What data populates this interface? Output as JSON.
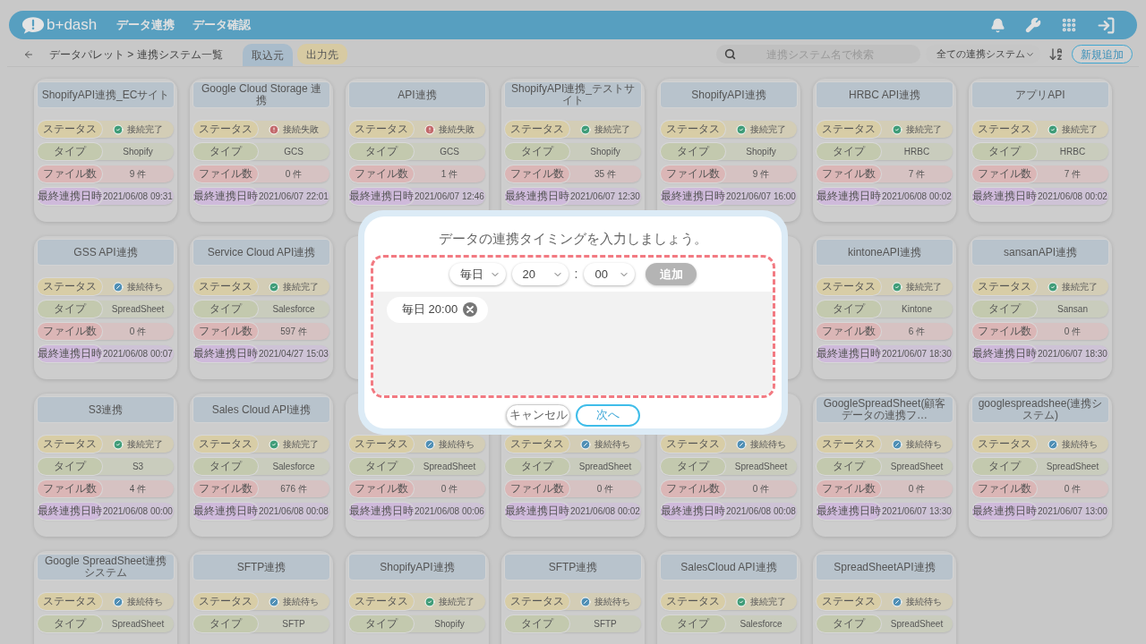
{
  "header": {
    "logo": "b+dash",
    "nav": [
      "データ連携",
      "データ確認"
    ]
  },
  "toolbar": {
    "breadcrumb": "データパレット > 連携システム一覧",
    "tabs": [
      {
        "label": "取込元",
        "selected": true
      },
      {
        "label": "出力先",
        "selected": false
      }
    ],
    "search": {
      "placeholder": "連携システム名で検索"
    },
    "filter": {
      "value": "全ての連携システム"
    },
    "new_button": "新規追加"
  },
  "cards": [
    {
      "title": "ShopifyAPI連携_ECサイト",
      "fields": [
        {
          "kind": "status",
          "label": "ステータス",
          "value": "接続完了",
          "icon": {
            "kind": "check",
            "color": "#3f9c78"
          }
        },
        {
          "kind": "type",
          "label": "タイプ",
          "value": "Shopify"
        },
        {
          "kind": "files",
          "label": "ファイル数",
          "value": "9 件"
        },
        {
          "kind": "date",
          "label": "最終連携日時",
          "value": "2021/06/08 09:31"
        }
      ]
    },
    {
      "title": "Google Cloud Storage 連携",
      "fields": [
        {
          "kind": "status",
          "label": "ステータス",
          "value": "接続失敗",
          "icon": {
            "kind": "alert",
            "color": "#c2696b"
          }
        },
        {
          "kind": "type",
          "label": "タイプ",
          "value": "GCS"
        },
        {
          "kind": "files",
          "label": "ファイル数",
          "value": "0 件"
        },
        {
          "kind": "date",
          "label": "最終連携日時",
          "value": "2021/06/07 22:01"
        }
      ]
    },
    {
      "title": "API連携",
      "fields": [
        {
          "kind": "status",
          "label": "ステータス",
          "value": "接続失敗",
          "icon": {
            "kind": "alert",
            "color": "#c2696b"
          }
        },
        {
          "kind": "type",
          "label": "タイプ",
          "value": "GCS"
        },
        {
          "kind": "files",
          "label": "ファイル数",
          "value": "1 件"
        },
        {
          "kind": "date",
          "label": "最終連携日時",
          "value": "2021/06/07 12:46"
        }
      ]
    },
    {
      "title": "ShopifyAPI連携_テストサイト",
      "fields": [
        {
          "kind": "status",
          "label": "ステータス",
          "value": "接続完了",
          "icon": {
            "kind": "check",
            "color": "#3f9c78"
          }
        },
        {
          "kind": "type",
          "label": "タイプ",
          "value": "Shopify"
        },
        {
          "kind": "files",
          "label": "ファイル数",
          "value": "35 件"
        },
        {
          "kind": "date",
          "label": "最終連携日時",
          "value": "2021/06/07 12:30"
        }
      ]
    },
    {
      "title": "ShopifyAPI連携",
      "fields": [
        {
          "kind": "status",
          "label": "ステータス",
          "value": "接続完了",
          "icon": {
            "kind": "check",
            "color": "#3f9c78"
          }
        },
        {
          "kind": "type",
          "label": "タイプ",
          "value": "Shopify"
        },
        {
          "kind": "files",
          "label": "ファイル数",
          "value": "9 件"
        },
        {
          "kind": "date",
          "label": "最終連携日時",
          "value": "2021/06/07 16:00"
        }
      ]
    },
    {
      "title": "HRBC API連携",
      "fields": [
        {
          "kind": "status",
          "label": "ステータス",
          "value": "接続完了",
          "icon": {
            "kind": "check",
            "color": "#3f9c78"
          }
        },
        {
          "kind": "type",
          "label": "タイプ",
          "value": "HRBC"
        },
        {
          "kind": "files",
          "label": "ファイル数",
          "value": "7 件"
        },
        {
          "kind": "date",
          "label": "最終連携日時",
          "value": "2021/06/08 00:02"
        }
      ]
    },
    {
      "title": "アプリAPI",
      "fields": [
        {
          "kind": "status",
          "label": "ステータス",
          "value": "接続完了",
          "icon": {
            "kind": "check",
            "color": "#3f9c78"
          }
        },
        {
          "kind": "type",
          "label": "タイプ",
          "value": "HRBC"
        },
        {
          "kind": "files",
          "label": "ファイル数",
          "value": "7 件"
        },
        {
          "kind": "date",
          "label": "最終連携日時",
          "value": "2021/06/08 00:02"
        }
      ]
    },
    {
      "title": "GSS API連携",
      "fields": [
        {
          "kind": "status",
          "label": "ステータス",
          "value": "接続待ち",
          "icon": {
            "kind": "slash",
            "color": "#4f8fb5"
          }
        },
        {
          "kind": "type",
          "label": "タイプ",
          "value": "SpreadSheet"
        },
        {
          "kind": "files",
          "label": "ファイル数",
          "value": "0 件"
        },
        {
          "kind": "date",
          "label": "最終連携日時",
          "value": "2021/06/08 00:07"
        }
      ]
    },
    {
      "title": "Service Cloud API連携",
      "fields": [
        {
          "kind": "status",
          "label": "ステータス",
          "value": "接続完了",
          "icon": {
            "kind": "check",
            "color": "#3f9c78"
          }
        },
        {
          "kind": "type",
          "label": "タイプ",
          "value": "Salesforce"
        },
        {
          "kind": "files",
          "label": "ファイル数",
          "value": "597 件"
        },
        {
          "kind": "date",
          "label": "最終連携日時",
          "value": "2021/04/27 15:03"
        }
      ]
    },
    {
      "kind": "covered"
    },
    {
      "kind": "hidden"
    },
    {
      "kind": "covered"
    },
    {
      "title": "kintoneAPI連携",
      "fields": [
        {
          "kind": "status",
          "label": "ステータス",
          "value": "接続完了",
          "icon": {
            "kind": "check",
            "color": "#3f9c78"
          }
        },
        {
          "kind": "type",
          "label": "タイプ",
          "value": "Kintone"
        },
        {
          "kind": "files",
          "label": "ファイル数",
          "value": "6 件"
        },
        {
          "kind": "date",
          "label": "最終連携日時",
          "value": "2021/06/07 18:30"
        }
      ]
    },
    {
      "title": "sansanAPI連携",
      "fields": [
        {
          "kind": "status",
          "label": "ステータス",
          "value": "接続完了",
          "icon": {
            "kind": "check",
            "color": "#3f9c78"
          }
        },
        {
          "kind": "type",
          "label": "タイプ",
          "value": "Sansan"
        },
        {
          "kind": "files",
          "label": "ファイル数",
          "value": "0 件"
        },
        {
          "kind": "date",
          "label": "最終連携日時",
          "value": "2021/06/07 18:30"
        }
      ]
    },
    {
      "title": "S3連携",
      "fields": [
        {
          "kind": "status",
          "label": "ステータス",
          "value": "接続完了",
          "icon": {
            "kind": "check",
            "color": "#3f9c78"
          }
        },
        {
          "kind": "type",
          "label": "タイプ",
          "value": "S3"
        },
        {
          "kind": "files",
          "label": "ファイル数",
          "value": "4 件"
        },
        {
          "kind": "date",
          "label": "最終連携日時",
          "value": "2021/06/08 00:00"
        }
      ]
    },
    {
      "title": "Sales Cloud API連携",
      "fields": [
        {
          "kind": "status",
          "label": "ステータス",
          "value": "接続完了",
          "icon": {
            "kind": "check",
            "color": "#3f9c78"
          }
        },
        {
          "kind": "type",
          "label": "タイプ",
          "value": "Salesforce"
        },
        {
          "kind": "files",
          "label": "ファイル数",
          "value": "676 件"
        },
        {
          "kind": "date",
          "label": "最終連携日時",
          "value": "2021/06/08 00:08"
        }
      ]
    },
    {
      "fields": [
        {
          "kind": "status",
          "label": "ステータス",
          "value": "接続待ち",
          "icon": {
            "kind": "slash",
            "color": "#4f8fb5"
          }
        },
        {
          "kind": "type",
          "label": "タイプ",
          "value": "SpreadSheet"
        },
        {
          "kind": "files",
          "label": "ファイル数",
          "value": "0 件"
        },
        {
          "kind": "date",
          "label": "最終連携日時",
          "value": "2021/06/08 00:06"
        }
      ]
    },
    {
      "fields": [
        {
          "kind": "status",
          "label": "ステータス",
          "value": "接続待ち",
          "icon": {
            "kind": "slash",
            "color": "#4f8fb5"
          }
        },
        {
          "kind": "type",
          "label": "タイプ",
          "value": "SpreadSheet"
        },
        {
          "kind": "files",
          "label": "ファイル数",
          "value": "0 件"
        },
        {
          "kind": "date",
          "label": "最終連携日時",
          "value": "2021/06/08 00:02"
        }
      ]
    },
    {
      "fields": [
        {
          "kind": "status",
          "label": "ステータス",
          "value": "接続待ち",
          "icon": {
            "kind": "slash",
            "color": "#4f8fb5"
          }
        },
        {
          "kind": "type",
          "label": "タイプ",
          "value": "SpreadSheet"
        },
        {
          "kind": "files",
          "label": "ファイル数",
          "value": "0 件"
        },
        {
          "kind": "date",
          "label": "最終連携日時",
          "value": "2021/06/08 00:08"
        }
      ]
    },
    {
      "title": "GoogleSpreadSheet(顧客データの連携フ…",
      "fields": [
        {
          "kind": "status",
          "label": "ステータス",
          "value": "接続待ち",
          "icon": {
            "kind": "slash",
            "color": "#4f8fb5"
          }
        },
        {
          "kind": "type",
          "label": "タイプ",
          "value": "SpreadSheet"
        },
        {
          "kind": "files",
          "label": "ファイル数",
          "value": "0 件"
        },
        {
          "kind": "date",
          "label": "最終連携日時",
          "value": "2021/06/07 13:30"
        }
      ]
    },
    {
      "title": "googlespreadshee(連携システム)",
      "fields": [
        {
          "kind": "status",
          "label": "ステータス",
          "value": "接続待ち",
          "icon": {
            "kind": "slash",
            "color": "#4f8fb5"
          }
        },
        {
          "kind": "type",
          "label": "タイプ",
          "value": "SpreadSheet"
        },
        {
          "kind": "files",
          "label": "ファイル数",
          "value": "0 件"
        },
        {
          "kind": "date",
          "label": "最終連携日時",
          "value": "2021/06/07 13:00"
        }
      ]
    },
    {
      "title": "Google SpreadSheet連携システム",
      "fields": [
        {
          "kind": "status",
          "label": "ステータス",
          "value": "接続待ち",
          "icon": {
            "kind": "slash",
            "color": "#4f8fb5"
          }
        },
        {
          "kind": "type",
          "label": "タイプ",
          "value": "SpreadSheet"
        }
      ]
    },
    {
      "title": "SFTP連携",
      "fields": [
        {
          "kind": "status",
          "label": "ステータス",
          "value": "接続待ち",
          "icon": {
            "kind": "slash",
            "color": "#4f8fb5"
          }
        },
        {
          "kind": "type",
          "label": "タイプ",
          "value": "SFTP"
        }
      ]
    },
    {
      "title": "ShopifyAPI連携",
      "fields": [
        {
          "kind": "status",
          "label": "ステータス",
          "value": "接続完了",
          "icon": {
            "kind": "check",
            "color": "#3f9c78"
          }
        },
        {
          "kind": "type",
          "label": "タイプ",
          "value": "Shopify"
        }
      ]
    },
    {
      "title": "SFTP連携",
      "fields": [
        {
          "kind": "status",
          "label": "ステータス",
          "value": "接続待ち",
          "icon": {
            "kind": "slash",
            "color": "#4f8fb5"
          }
        },
        {
          "kind": "type",
          "label": "タイプ",
          "value": "SFTP"
        }
      ]
    },
    {
      "title": "SalesCloud API連携",
      "fields": [
        {
          "kind": "status",
          "label": "ステータス",
          "value": "接続完了",
          "icon": {
            "kind": "check",
            "color": "#3f9c78"
          }
        },
        {
          "kind": "type",
          "label": "タイプ",
          "value": "Salesforce"
        }
      ]
    },
    {
      "title": "SpreadSheetAPI連携",
      "fields": [
        {
          "kind": "status",
          "label": "ステータス",
          "value": "接続待ち",
          "icon": {
            "kind": "slash",
            "color": "#4f8fb5"
          }
        },
        {
          "kind": "type",
          "label": "タイプ",
          "value": "SpreadSheet"
        }
      ]
    }
  ],
  "dialog": {
    "title": "データの連携タイミングを入力しましょう。",
    "selects": [
      {
        "value": "毎日"
      },
      {
        "value": "20"
      },
      {
        "value": "00"
      }
    ],
    "separator": ":",
    "add_button": {
      "label": "追加",
      "disabled": true
    },
    "chips": [
      {
        "label": "毎日 20:00"
      }
    ],
    "buttons": [
      {
        "kind": "cancel",
        "label": "キャンセル"
      },
      {
        "kind": "next",
        "label": "次へ"
      }
    ]
  }
}
